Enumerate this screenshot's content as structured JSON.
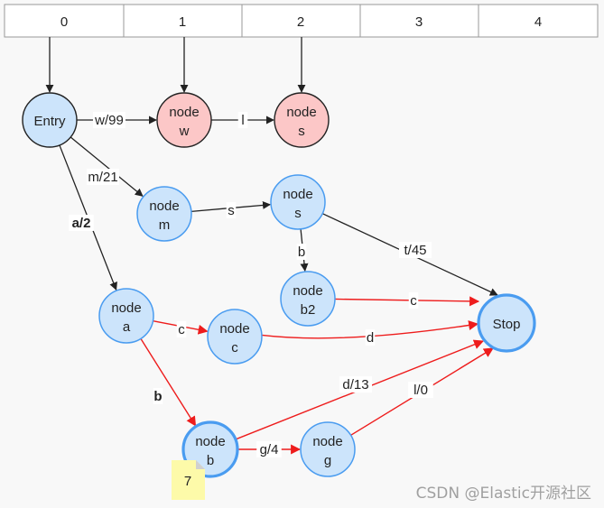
{
  "array": {
    "cells": [
      "0",
      "1",
      "2",
      "3",
      "4"
    ]
  },
  "colors": {
    "blue_fill": "#cce4fb",
    "blue_stroke": "#4a9cf0",
    "red_fill": "#fcc7c7",
    "black_stroke": "#222222",
    "red_edge": "#ee1c1c",
    "note_fill": "#fdfaa9"
  },
  "nodes": [
    {
      "id": "entry",
      "lines": [
        "Entry"
      ],
      "style": "blue-black"
    },
    {
      "id": "w",
      "lines": [
        "node",
        "w"
      ],
      "style": "red"
    },
    {
      "id": "s_red",
      "lines": [
        "node",
        "s"
      ],
      "style": "red"
    },
    {
      "id": "m",
      "lines": [
        "node",
        "m"
      ],
      "style": "blue"
    },
    {
      "id": "s",
      "lines": [
        "node",
        "s"
      ],
      "style": "blue"
    },
    {
      "id": "b2",
      "lines": [
        "node",
        "b2"
      ],
      "style": "blue"
    },
    {
      "id": "a",
      "lines": [
        "node",
        "a"
      ],
      "style": "blue"
    },
    {
      "id": "c",
      "lines": [
        "node",
        "c"
      ],
      "style": "blue"
    },
    {
      "id": "stop",
      "lines": [
        "Stop"
      ],
      "style": "blue-thick"
    },
    {
      "id": "b",
      "lines": [
        "node",
        "b"
      ],
      "style": "blue-thick"
    },
    {
      "id": "g",
      "lines": [
        "node",
        "g"
      ],
      "style": "blue"
    }
  ],
  "edges": [
    {
      "from": "cell0",
      "to": "entry",
      "label": "",
      "color": "black"
    },
    {
      "from": "cell1",
      "to": "w",
      "label": "",
      "color": "black"
    },
    {
      "from": "cell2",
      "to": "s_red",
      "label": "",
      "color": "black"
    },
    {
      "from": "entry",
      "to": "w",
      "label": "w/99",
      "color": "black"
    },
    {
      "from": "w",
      "to": "s_red",
      "label": "l",
      "color": "black"
    },
    {
      "from": "entry",
      "to": "m",
      "label": "m/21",
      "color": "black"
    },
    {
      "from": "entry",
      "to": "a",
      "label": "a/2",
      "color": "black",
      "bold": true
    },
    {
      "from": "m",
      "to": "s",
      "label": "s",
      "color": "black"
    },
    {
      "from": "s",
      "to": "b2",
      "label": "b",
      "color": "black"
    },
    {
      "from": "s",
      "to": "stop",
      "label": "t/45",
      "color": "black"
    },
    {
      "from": "b2",
      "to": "stop",
      "label": "c",
      "color": "red"
    },
    {
      "from": "a",
      "to": "c",
      "label": "c",
      "color": "red"
    },
    {
      "from": "c",
      "to": "stop",
      "label": "d",
      "color": "red"
    },
    {
      "from": "a",
      "to": "b",
      "label": "b",
      "color": "red",
      "bold": true
    },
    {
      "from": "b",
      "to": "stop",
      "label": "d/13",
      "color": "red"
    },
    {
      "from": "b",
      "to": "g",
      "label": "g/4",
      "color": "red"
    },
    {
      "from": "g",
      "to": "stop",
      "label": "l/0",
      "color": "red"
    }
  ],
  "note": {
    "text": "7"
  },
  "watermark": "CSDN @Elastic开源社区"
}
